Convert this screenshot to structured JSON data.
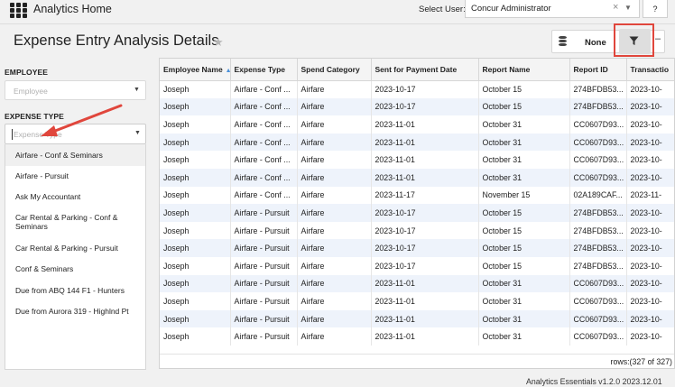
{
  "topbar": {
    "app_title": "Analytics Home",
    "select_user_label": "Select User:",
    "selected_user": "Concur Administrator",
    "clear_glyph": "×",
    "help_label": "?"
  },
  "header": {
    "page_title": "Expense Entry Analysis Details",
    "bookmark_label": "None"
  },
  "filters": {
    "employee_label": "EMPLOYEE",
    "employee_placeholder": "Employee",
    "expense_type_label": "EXPENSE TYPE",
    "expense_type_placeholder": "Expense Type",
    "expense_type_options": [
      "Airfare - Conf & Seminars",
      "Airfare - Pursuit",
      "Ask My Accountant",
      "Car Rental & Parking - Conf & Seminars",
      "Car Rental & Parking - Pursuit",
      "Conf & Seminars",
      "Due from ABQ 144 F1 - Hunters",
      "Due from Aurora 319 - Highlnd Pt"
    ]
  },
  "table": {
    "columns": [
      "Employee Name",
      "Expense Type",
      "Spend Category",
      "Sent for Payment Date",
      "Report Name",
      "Report ID",
      "Transactio"
    ],
    "rows": [
      [
        "Joseph",
        "Airfare - Conf ...",
        "Airfare",
        "2023-10-17",
        "October 15",
        "274BFDB53...",
        "2023-10-"
      ],
      [
        "Joseph",
        "Airfare - Conf ...",
        "Airfare",
        "2023-10-17",
        "October 15",
        "274BFDB53...",
        "2023-10-"
      ],
      [
        "Joseph",
        "Airfare - Conf ...",
        "Airfare",
        "2023-11-01",
        "October 31",
        "CC0607D93...",
        "2023-10-"
      ],
      [
        "Joseph",
        "Airfare - Conf ...",
        "Airfare",
        "2023-11-01",
        "October 31",
        "CC0607D93...",
        "2023-10-"
      ],
      [
        "Joseph",
        "Airfare - Conf ...",
        "Airfare",
        "2023-11-01",
        "October 31",
        "CC0607D93...",
        "2023-10-"
      ],
      [
        "Joseph",
        "Airfare - Conf ...",
        "Airfare",
        "2023-11-01",
        "October 31",
        "CC0607D93...",
        "2023-10-"
      ],
      [
        "Joseph",
        "Airfare - Conf ...",
        "Airfare",
        "2023-11-17",
        "November 15",
        "02A189CAF...",
        "2023-11-"
      ],
      [
        "Joseph",
        "Airfare - Pursuit",
        "Airfare",
        "2023-10-17",
        "October 15",
        "274BFDB53...",
        "2023-10-"
      ],
      [
        "Joseph",
        "Airfare - Pursuit",
        "Airfare",
        "2023-10-17",
        "October 15",
        "274BFDB53...",
        "2023-10-"
      ],
      [
        "Joseph",
        "Airfare - Pursuit",
        "Airfare",
        "2023-10-17",
        "October 15",
        "274BFDB53...",
        "2023-10-"
      ],
      [
        "Joseph",
        "Airfare - Pursuit",
        "Airfare",
        "2023-10-17",
        "October 15",
        "274BFDB53...",
        "2023-10-"
      ],
      [
        "Joseph",
        "Airfare - Pursuit",
        "Airfare",
        "2023-11-01",
        "October 31",
        "CC0607D93...",
        "2023-10-"
      ],
      [
        "Joseph",
        "Airfare - Pursuit",
        "Airfare",
        "2023-11-01",
        "October 31",
        "CC0607D93...",
        "2023-10-"
      ],
      [
        "Joseph",
        "Airfare - Pursuit",
        "Airfare",
        "2023-11-01",
        "October 31",
        "CC0607D93...",
        "2023-10-"
      ],
      [
        "Joseph",
        "Airfare - Pursuit",
        "Airfare",
        "2023-11-01",
        "October 31",
        "CC0607D93...",
        "2023-10-"
      ]
    ],
    "rows_count": "rows:(327 of 327)"
  },
  "footer": {
    "version": "Analytics Essentials v1.2.0 2023.12.01"
  },
  "colors": {
    "annotation_red": "#e0463c",
    "row_alt": "#eef3fb",
    "sort_accent": "#4a90d9"
  },
  "icons": {
    "apps": "grid-icon",
    "favorite": "star-icon",
    "bookmarks": "database-icon",
    "filter": "filter-icon",
    "annotation": "red-arrow-icon"
  }
}
